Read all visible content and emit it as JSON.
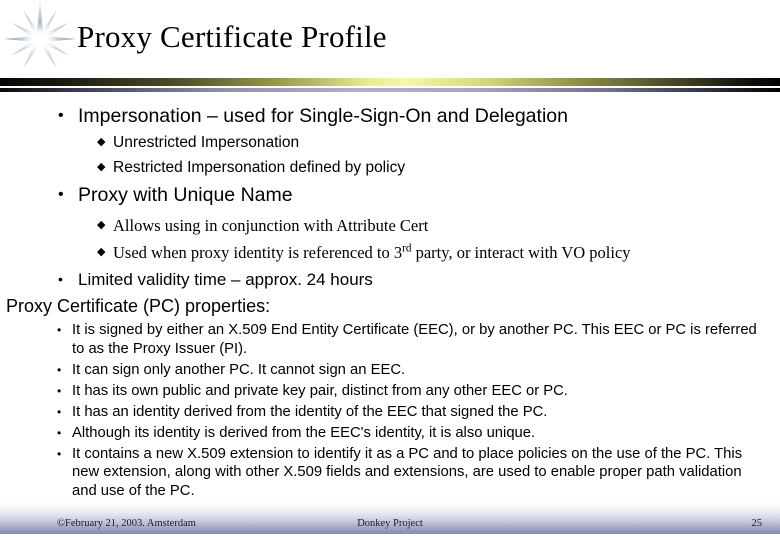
{
  "slide": {
    "title": "Proxy Certificate Profile",
    "decor_icon": "starburst-icon",
    "accent_color": "#f7f7ad",
    "footer_accent_color": "#8a8ab0"
  },
  "outline": {
    "items": [
      {
        "level": 1,
        "bullet": "•",
        "text": "Impersonation – used for Single-Sign-On and Delegation"
      },
      {
        "level": 2,
        "bullet": "◆",
        "text": "Unrestricted Impersonation"
      },
      {
        "level": 2,
        "bullet": "◆",
        "text": "Restricted Impersonation defined by policy"
      },
      {
        "level": 1,
        "bullet": "•",
        "text": "Proxy with Unique Name"
      },
      {
        "level": 2,
        "bullet": "◆",
        "text": "Allows using in conjunction with Attribute Cert"
      },
      {
        "level": 2,
        "bullet": "◆",
        "text_before": "Used when proxy identity is referenced to 3",
        "superscript": "rd",
        "text_after": " party, or interact with VO policy"
      },
      {
        "level": 1,
        "bullet": "•",
        "text": "Limited validity time – approx. 24 hours"
      }
    ]
  },
  "properties_section": {
    "heading": "Proxy Certificate (PC) properties:",
    "bullet": "•",
    "items": [
      "It is signed by either an X.509 End Entity Certificate (EEC), or by another PC. This EEC or PC is referred to as the Proxy Issuer (PI).",
      "It can sign only another PC. It cannot sign an EEC.",
      "It has its own public and private key pair, distinct from any other EEC or PC.",
      "It has an identity derived from the identity of the EEC that signed the PC.",
      "Although its identity is derived from the EEC's identity, it is also unique.",
      "It contains a new X.509 extension to identify it as a PC and to place policies on the use of the PC. This new extension, along with other X.509 fields and extensions, are used to enable proper path validation and use of the PC."
    ]
  },
  "footer": {
    "left": "©February 21, 2003. Amsterdam",
    "center": "Donkey Project",
    "page_number": "25"
  }
}
